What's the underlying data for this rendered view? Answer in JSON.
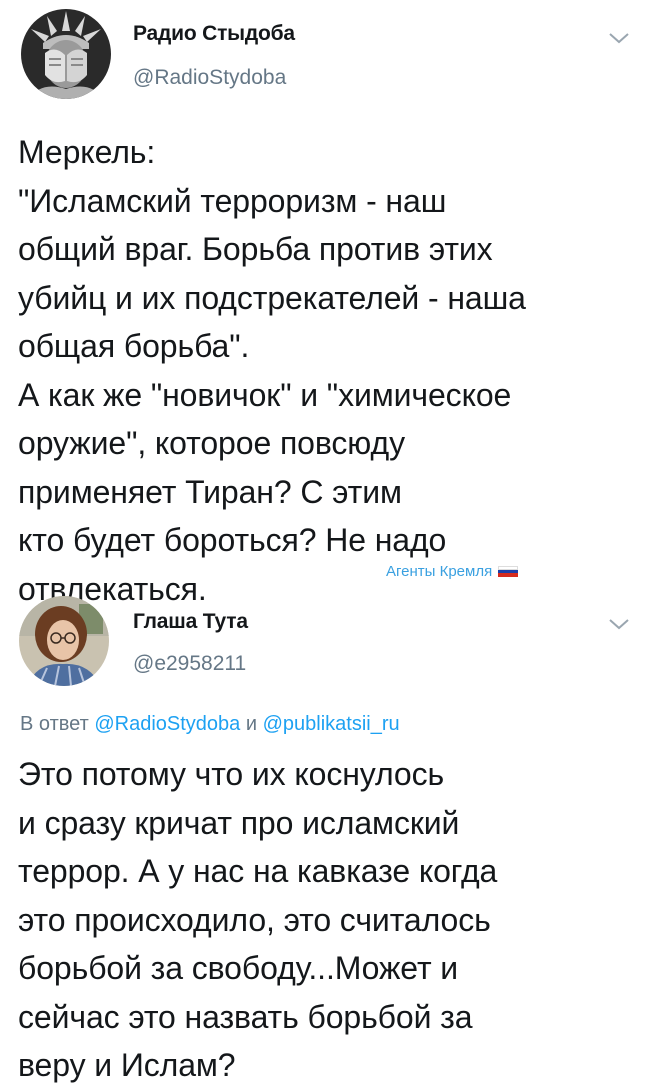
{
  "tweets": [
    {
      "author_name": "Радио Стыдоба",
      "author_handle": "@RadioStydoba",
      "text_lines": [
        "Меркель:",
        "\"Исламский терроризм - наш",
        "общий враг. Борьба против этих",
        "убийц и их подстрекателей - наша",
        "общая борьба\".",
        "А как же \"новичок\" и \"химическое",
        "оружие\", которое повсюду",
        "применяет Тиран? С этим",
        "кто будет бороться? Не надо",
        "отвлекаться."
      ],
      "watermark": "Агенты Кремля",
      "flag_colors": [
        "#ffffff",
        "#1c3fa8",
        "#d52b1e"
      ]
    },
    {
      "author_name": "Глаша Тута",
      "author_handle": "@e2958211",
      "reply_prefix": "В ответ",
      "reply_to_1": "@RadioStydoba",
      "reply_joiner": "и",
      "reply_to_2": "@publikatsii_ru",
      "text_lines": [
        "Это потому что их коснулось",
        "и сразу кричат про исламский",
        "террор. А у нас на кавказе когда",
        "это происходило, это считалось",
        "борьбой за свободу...Может и",
        "сейчас это назвать борьбой за",
        "веру и Ислам?"
      ]
    }
  ],
  "icons": {
    "menu": "chevron-down-icon",
    "avatar_1": "statue-of-liberty-facepalm",
    "avatar_2": "woman-portrait"
  },
  "colors": {
    "text": "#14171a",
    "secondary": "#657786",
    "link": "#1da1f2",
    "watermark": "#3aa0e0"
  }
}
